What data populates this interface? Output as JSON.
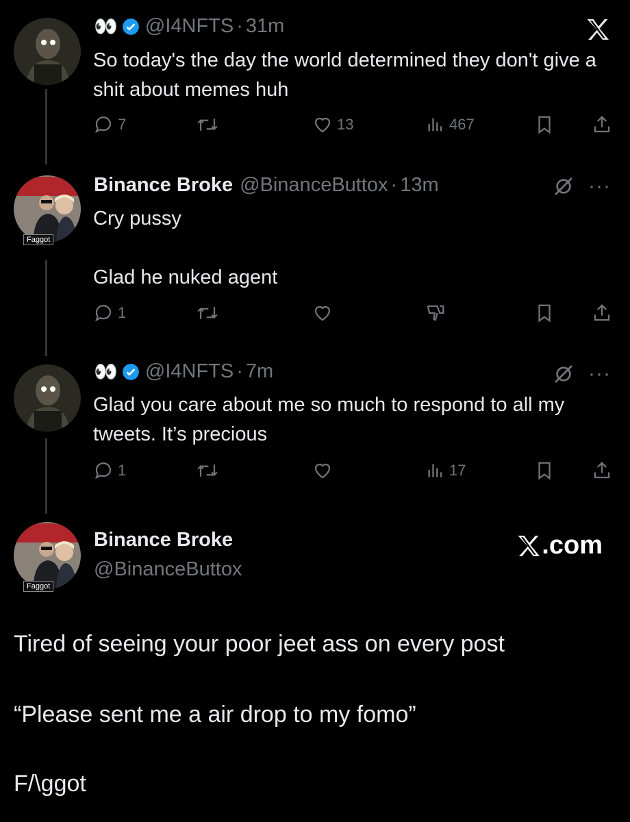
{
  "tweet1": {
    "emoji": "👀",
    "handle": "@I4NFTS",
    "sep": "·",
    "time": "31m",
    "text": "So today's the day the world determined they don't give a shit about memes huh",
    "replies": "7",
    "likes": "13",
    "views": "467"
  },
  "tweet2": {
    "name": "Binance Broke",
    "handle": "@BinanceButtox",
    "sep": "·",
    "time": "13m",
    "avatar_tag": "Faggot",
    "text": "Cry pussy\n\nGlad he nuked agent",
    "replies": "1",
    "more": "···"
  },
  "tweet3": {
    "emoji": "👀",
    "handle": "@I4NFTS",
    "sep": "·",
    "time": "7m",
    "text": "Glad you care about me so much to respond to all my tweets. It’s precious",
    "replies": "1",
    "views": "17",
    "more": "···"
  },
  "tweet4": {
    "name": "Binance Broke",
    "handle": "@BinanceButtox",
    "avatar_tag": "Faggot",
    "brand": ".com",
    "line1": "Tired of seeing your poor jeet ass on every post",
    "line2": "“Please sent me a air drop to my fomo”",
    "line3": "F/\\ggot"
  },
  "colors": {
    "background": "#000000",
    "text": "#e7e9ea",
    "muted": "#71767b",
    "verified": "#1d9bf0"
  },
  "icons": [
    "x-logo-icon",
    "verified-icon",
    "reply-icon",
    "retweet-icon",
    "like-icon",
    "views-icon",
    "bookmark-icon",
    "share-icon",
    "grok-icon",
    "dislike-icon"
  ]
}
